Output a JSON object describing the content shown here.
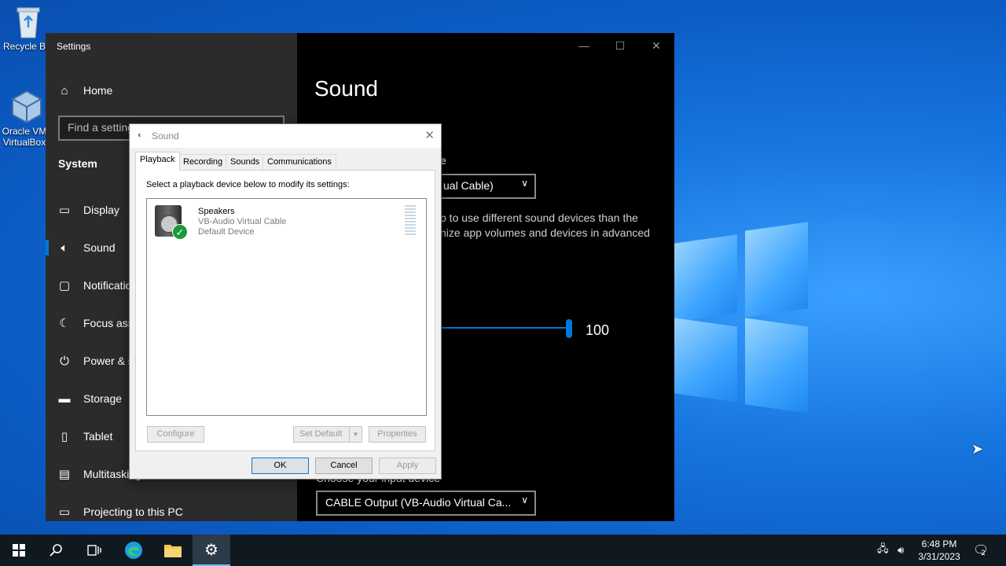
{
  "desktop": {
    "icons": [
      {
        "label": "Recycle Bin",
        "name": "recycle-bin-icon"
      },
      {
        "label": "Oracle VM VirtualBox",
        "name": "virtualbox-icon"
      }
    ]
  },
  "settings": {
    "title": "Settings",
    "home_label": "Home",
    "search_placeholder": "Find a setting",
    "section": "System",
    "nav": [
      {
        "label": "Display",
        "icon": "display-icon"
      },
      {
        "label": "Sound",
        "icon": "speaker-icon"
      },
      {
        "label": "Notifications & actions",
        "icon": "notification-icon"
      },
      {
        "label": "Focus assist",
        "icon": "moon-icon"
      },
      {
        "label": "Power & sleep",
        "icon": "power-icon"
      },
      {
        "label": "Storage",
        "icon": "storage-icon"
      },
      {
        "label": "Tablet",
        "icon": "tablet-icon"
      },
      {
        "label": "Multitasking",
        "icon": "multitasking-icon"
      },
      {
        "label": "Projecting to this PC",
        "icon": "projector-icon"
      }
    ],
    "page_title": "Sound",
    "output_label_fragment": "e",
    "output_device_value": "ual Cable)",
    "output_note_line1": "p to use different sound devices than the",
    "output_note_line2": "nize app volumes and devices in advanced",
    "volume_value": "100",
    "input_label_fragment": "Choose your input device",
    "input_device_value": "CABLE Output (VB-Audio Virtual Ca..."
  },
  "dialog": {
    "title": "Sound",
    "tabs": [
      "Playback",
      "Recording",
      "Sounds",
      "Communications"
    ],
    "hint": "Select a playback device below to modify its settings:",
    "device": {
      "name": "Speakers",
      "driver": "VB-Audio Virtual Cable",
      "status": "Default Device"
    },
    "buttons": {
      "configure": "Configure",
      "set_default": "Set Default",
      "properties": "Properties",
      "ok": "OK",
      "cancel": "Cancel",
      "apply": "Apply"
    }
  },
  "taskbar": {
    "time": "6:48 PM",
    "date": "3/31/2023",
    "notification_count": "2"
  },
  "colors": {
    "accent": "#0078d7",
    "desktop_blue": "#1877e0"
  }
}
